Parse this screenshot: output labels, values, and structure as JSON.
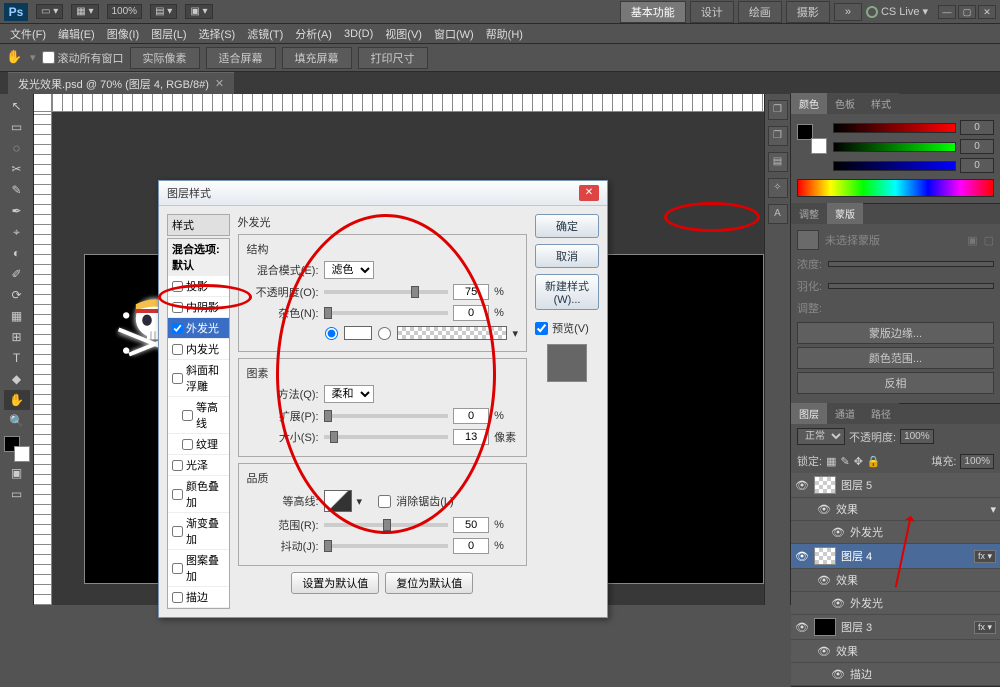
{
  "titlebar": {
    "logo": "Ps",
    "zoom": "100%",
    "workspace_active": "基本功能",
    "workspaces": [
      "设计",
      "绘画",
      "摄影"
    ],
    "cslive": "CS Live"
  },
  "menubar": [
    "文件(F)",
    "编辑(E)",
    "图像(I)",
    "图层(L)",
    "选择(S)",
    "滤镜(T)",
    "分析(A)",
    "3D(D)",
    "视图(V)",
    "窗口(W)",
    "帮助(H)"
  ],
  "optionbar": {
    "scroll_all": "滚动所有窗口",
    "btns": [
      "实际像素",
      "适合屏幕",
      "填充屏幕",
      "打印尺寸"
    ]
  },
  "doctab": "发光效果.psd @ 70% (图层 4, RGB/8#)",
  "tools": [
    "↖",
    "▭",
    "◌",
    "✂",
    "✎",
    "✒",
    "⌖",
    "◐",
    "✐",
    "⟳",
    "▦",
    "⊞",
    "T",
    "◆",
    "✋",
    "🔍"
  ],
  "minidock": [
    "❐",
    "❐",
    "▤",
    "✧",
    "A"
  ],
  "color_panel": {
    "tabs": [
      "颜色",
      "色板",
      "样式"
    ],
    "sliders": [
      {
        "color": "linear-gradient(90deg,#000,#f00)",
        "val": "0"
      },
      {
        "color": "linear-gradient(90deg,#000,#0f0)",
        "val": "0"
      },
      {
        "color": "linear-gradient(90deg,#000,#00f)",
        "val": "0"
      }
    ]
  },
  "adjust_panel": {
    "tabs": [
      "调整",
      "蒙版"
    ],
    "no_mask": "未选择蒙版",
    "density": "浓度:",
    "feather": "羽化:",
    "refine": "调整:",
    "btns": [
      "蒙版边缘...",
      "颜色范围...",
      "反相"
    ]
  },
  "layer_panel": {
    "tabs": [
      "图层",
      "通道",
      "路径"
    ],
    "mode": "正常",
    "opacity_label": "不透明度:",
    "opacity": "100%",
    "lock_label": "锁定:",
    "fill_label": "填充:",
    "fill": "100%",
    "layers": [
      {
        "name": "图层 5",
        "thumb": "checker"
      },
      {
        "name": "效果",
        "sub": true
      },
      {
        "name": "外发光",
        "subsub": true
      },
      {
        "name": "图层 4",
        "thumb": "checker",
        "selected": true,
        "fx": true
      },
      {
        "name": "效果",
        "sub": true
      },
      {
        "name": "外发光",
        "subsub": true
      },
      {
        "name": "图层 3",
        "thumb": "black",
        "fx": true
      },
      {
        "name": "效果",
        "sub": true
      },
      {
        "name": "描边",
        "subsub": true
      }
    ]
  },
  "dialog": {
    "title": "图层样式",
    "left_header": "样式",
    "left_items": [
      {
        "label": "混合选项:默认",
        "header": true
      },
      {
        "label": "投影",
        "checked": false
      },
      {
        "label": "内阴影",
        "checked": false
      },
      {
        "label": "外发光",
        "checked": true,
        "selected": true
      },
      {
        "label": "内发光",
        "checked": false
      },
      {
        "label": "斜面和浮雕",
        "checked": false
      },
      {
        "label": "等高线",
        "checked": false,
        "indent": true
      },
      {
        "label": "纹理",
        "checked": false,
        "indent": true
      },
      {
        "label": "光泽",
        "checked": false
      },
      {
        "label": "颜色叠加",
        "checked": false
      },
      {
        "label": "渐变叠加",
        "checked": false
      },
      {
        "label": "图案叠加",
        "checked": false
      },
      {
        "label": "描边",
        "checked": false
      }
    ],
    "section_title": "外发光",
    "structure": {
      "legend": "结构",
      "blend_mode_label": "混合模式(E):",
      "blend_mode": "滤色",
      "opacity_label": "不透明度(O):",
      "opacity": "75",
      "noise_label": "杂色(N):",
      "noise": "0"
    },
    "elements": {
      "legend": "图素",
      "technique_label": "方法(Q):",
      "technique": "柔和",
      "spread_label": "扩展(P):",
      "spread": "0",
      "size_label": "大小(S):",
      "size": "13",
      "size_unit": "像素"
    },
    "quality": {
      "legend": "品质",
      "contour_label": "等高线:",
      "antialias": "消除锯齿(L)",
      "range_label": "范围(R):",
      "range": "50",
      "jitter_label": "抖动(J):",
      "jitter": "0"
    },
    "bottom_btns": [
      "设置为默认值",
      "复位为默认值"
    ],
    "right_btns": {
      "ok": "确定",
      "cancel": "取消",
      "new_style": "新建样式(W)...",
      "preview": "预览(V)"
    }
  }
}
